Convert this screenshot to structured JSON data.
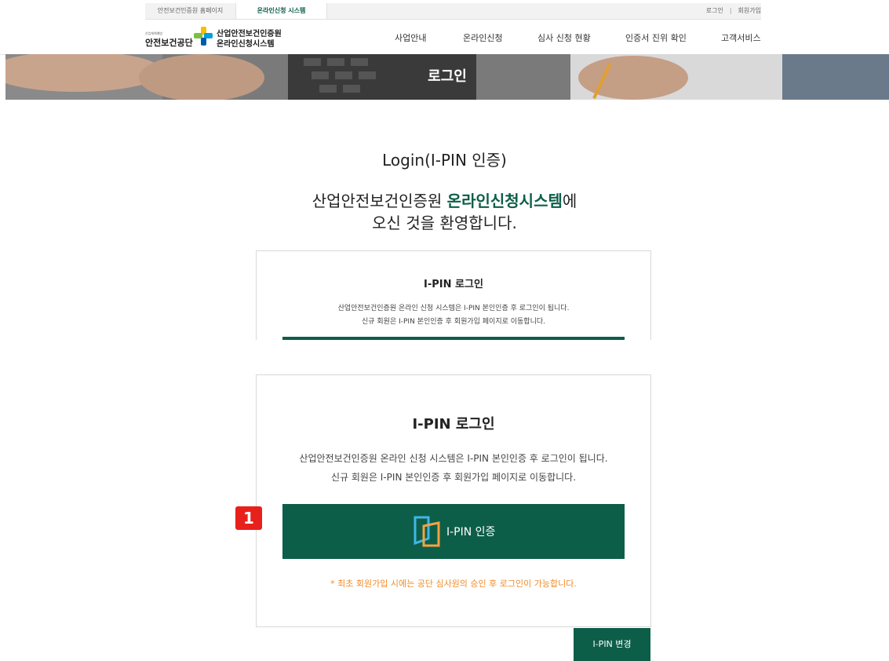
{
  "topbar": {
    "home_link": "안전보건인증원 홈페이지",
    "active_tab": "온라인신청 시스템",
    "login_link": "로그인",
    "separator": "|",
    "signup_link": "회원가입"
  },
  "header": {
    "logo_small": "산업재해예방",
    "logo_org": "안전보건공단",
    "logo_sys_line1": "산업안전보건인증원",
    "logo_sys_line2": "온라인신청시스템",
    "nav": [
      "사업안내",
      "온라인신청",
      "심사 신청 현황",
      "인증서 진위 확인",
      "고객서비스"
    ]
  },
  "banner": {
    "title": "로그인"
  },
  "main": {
    "login_title": "Login(I-PIN 인증)",
    "welcome_prefix": "산업안전보건인증원 ",
    "welcome_highlight": "온라인신청시스템",
    "welcome_suffix": "에",
    "welcome_line2": "오신 것을 환영합니다."
  },
  "card_small": {
    "title": "I-PIN 로그인",
    "desc1": "산업안전보건인증원 온라인 신청 시스템은 I-PIN 본인인증 후 로그인이 됩니다.",
    "desc2": "신규 회원은 I-PIN 본인인증 후 회원가입 페이지로 이동합니다."
  },
  "card_large": {
    "title": "I-PIN 로그인",
    "desc1": "산업안전보건인증원 온라인 신청 시스템은 I-PIN 본인인증 후 로그인이 됩니다.",
    "desc2": "신규 회원은 I-PIN 본인인증 후 회원가입 페이지로 이동합니다.",
    "button_label": "I-PIN 인증",
    "button_icon": "ipin-icon",
    "notice": "* 최초 회원가입 시에는 공단 심사원의 승인 후 로그인이 가능합니다."
  },
  "marker": {
    "label": "1"
  },
  "footer_button": {
    "label": "I-PIN 변경"
  },
  "colors": {
    "brand_green": "#0d5e49",
    "notice_orange": "#f08c28",
    "marker_red": "#e8201c"
  }
}
